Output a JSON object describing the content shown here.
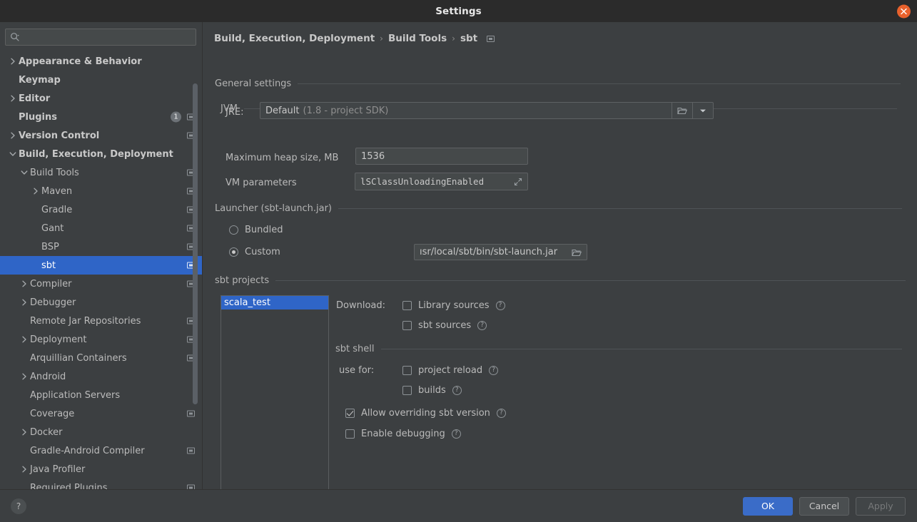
{
  "window": {
    "title": "Settings",
    "close_icon": "close-icon"
  },
  "sidebar": {
    "search": {
      "placeholder": "",
      "value": "",
      "icon": "search-icon"
    },
    "items": [
      {
        "label": "Appearance & Behavior",
        "arrow": "chevron-right",
        "indent": 0,
        "bold": true,
        "badge": "",
        "module_icon": false,
        "selected": false
      },
      {
        "label": "Keymap",
        "arrow": "",
        "indent": 0,
        "bold": true,
        "badge": "",
        "module_icon": false,
        "selected": false
      },
      {
        "label": "Editor",
        "arrow": "chevron-right",
        "indent": 0,
        "bold": true,
        "badge": "",
        "module_icon": false,
        "selected": false
      },
      {
        "label": "Plugins",
        "arrow": "",
        "indent": 0,
        "bold": true,
        "badge": "1",
        "module_icon": true,
        "selected": false
      },
      {
        "label": "Version Control",
        "arrow": "chevron-right",
        "indent": 0,
        "bold": true,
        "badge": "",
        "module_icon": true,
        "selected": false
      },
      {
        "label": "Build, Execution, Deployment",
        "arrow": "chevron-down",
        "indent": 0,
        "bold": true,
        "badge": "",
        "module_icon": false,
        "selected": false
      },
      {
        "label": "Build Tools",
        "arrow": "chevron-down",
        "indent": 1,
        "bold": false,
        "badge": "",
        "module_icon": true,
        "selected": false
      },
      {
        "label": "Maven",
        "arrow": "chevron-right",
        "indent": 2,
        "bold": false,
        "badge": "",
        "module_icon": true,
        "selected": false
      },
      {
        "label": "Gradle",
        "arrow": "",
        "indent": 2,
        "bold": false,
        "badge": "",
        "module_icon": true,
        "selected": false
      },
      {
        "label": "Gant",
        "arrow": "",
        "indent": 2,
        "bold": false,
        "badge": "",
        "module_icon": true,
        "selected": false
      },
      {
        "label": "BSP",
        "arrow": "",
        "indent": 2,
        "bold": false,
        "badge": "",
        "module_icon": true,
        "selected": false
      },
      {
        "label": "sbt",
        "arrow": "",
        "indent": 2,
        "bold": false,
        "badge": "",
        "module_icon": true,
        "selected": true
      },
      {
        "label": "Compiler",
        "arrow": "chevron-right",
        "indent": 1,
        "bold": false,
        "badge": "",
        "module_icon": true,
        "selected": false
      },
      {
        "label": "Debugger",
        "arrow": "chevron-right",
        "indent": 1,
        "bold": false,
        "badge": "",
        "module_icon": false,
        "selected": false
      },
      {
        "label": "Remote Jar Repositories",
        "arrow": "",
        "indent": 1,
        "bold": false,
        "badge": "",
        "module_icon": true,
        "selected": false
      },
      {
        "label": "Deployment",
        "arrow": "chevron-right",
        "indent": 1,
        "bold": false,
        "badge": "",
        "module_icon": true,
        "selected": false
      },
      {
        "label": "Arquillian Containers",
        "arrow": "",
        "indent": 1,
        "bold": false,
        "badge": "",
        "module_icon": true,
        "selected": false
      },
      {
        "label": "Android",
        "arrow": "chevron-right",
        "indent": 1,
        "bold": false,
        "badge": "",
        "module_icon": false,
        "selected": false
      },
      {
        "label": "Application Servers",
        "arrow": "",
        "indent": 1,
        "bold": false,
        "badge": "",
        "module_icon": false,
        "selected": false
      },
      {
        "label": "Coverage",
        "arrow": "",
        "indent": 1,
        "bold": false,
        "badge": "",
        "module_icon": true,
        "selected": false
      },
      {
        "label": "Docker",
        "arrow": "chevron-right",
        "indent": 1,
        "bold": false,
        "badge": "",
        "module_icon": false,
        "selected": false
      },
      {
        "label": "Gradle-Android Compiler",
        "arrow": "",
        "indent": 1,
        "bold": false,
        "badge": "",
        "module_icon": true,
        "selected": false
      },
      {
        "label": "Java Profiler",
        "arrow": "chevron-right",
        "indent": 1,
        "bold": false,
        "badge": "",
        "module_icon": false,
        "selected": false
      },
      {
        "label": "Required Plugins",
        "arrow": "",
        "indent": 1,
        "bold": false,
        "badge": "",
        "module_icon": true,
        "selected": false
      }
    ]
  },
  "main": {
    "breadcrumb": {
      "part1": "Build, Execution, Deployment",
      "sep1": "›",
      "part2": "Build Tools",
      "sep2": "›",
      "part3": "sbt",
      "module_icon": "module-scope-icon"
    },
    "general_settings": {
      "title": "General settings"
    },
    "jvm": {
      "title": "JVM",
      "jre_label": "JRE:",
      "jre_value": "Default",
      "jre_hint": "(1.8 - project SDK)",
      "jre_browse_icon": "folder-icon",
      "jre_dropdown_icon": "chevron-down-icon",
      "heap_label": "Maximum heap size, MB",
      "heap_value": "1536",
      "vm_label": "VM parameters",
      "vm_value": "lSClassUnloadingEnabled",
      "vm_expand_icon": "expand-icon"
    },
    "launcher": {
      "title": "Launcher (sbt-launch.jar)",
      "bundled_label": "Bundled",
      "bundled_selected": false,
      "custom_label": "Custom",
      "custom_selected": true,
      "custom_path": "ısr/local/sbt/bin/sbt-launch.jar",
      "custom_browse_icon": "folder-icon"
    },
    "sbt_projects": {
      "title": "sbt projects",
      "projects": [
        {
          "name": "scala_test",
          "selected": true
        }
      ],
      "download_label": "Download:",
      "download_options": [
        {
          "label": "Library sources",
          "checked": false,
          "help": "?"
        },
        {
          "label": "sbt sources",
          "checked": false,
          "help": "?"
        }
      ],
      "sbt_shell_title": "sbt shell",
      "use_for_label": "use for:",
      "use_for_options": [
        {
          "label": "project reload",
          "checked": false,
          "help": "?"
        },
        {
          "label": "builds",
          "checked": false,
          "help": "?"
        }
      ],
      "extra_options": [
        {
          "label": "Allow overriding sbt version",
          "checked": true,
          "help": "?"
        },
        {
          "label": "Enable debugging",
          "checked": false,
          "help": "?"
        }
      ]
    }
  },
  "footer": {
    "help_label": "?",
    "ok_label": "OK",
    "cancel_label": "Cancel",
    "apply_label": "Apply",
    "apply_enabled": false
  },
  "colors": {
    "background": "#3c3f41",
    "titlebar": "#2b2b2b",
    "accent_selection": "#2f65c7",
    "primary_button": "#3a6cc8",
    "close_button": "#e8612c",
    "text": "#bbbbbb",
    "muted_text": "#8f8f8f",
    "field_background": "#45494a",
    "border": "#5e6163"
  }
}
